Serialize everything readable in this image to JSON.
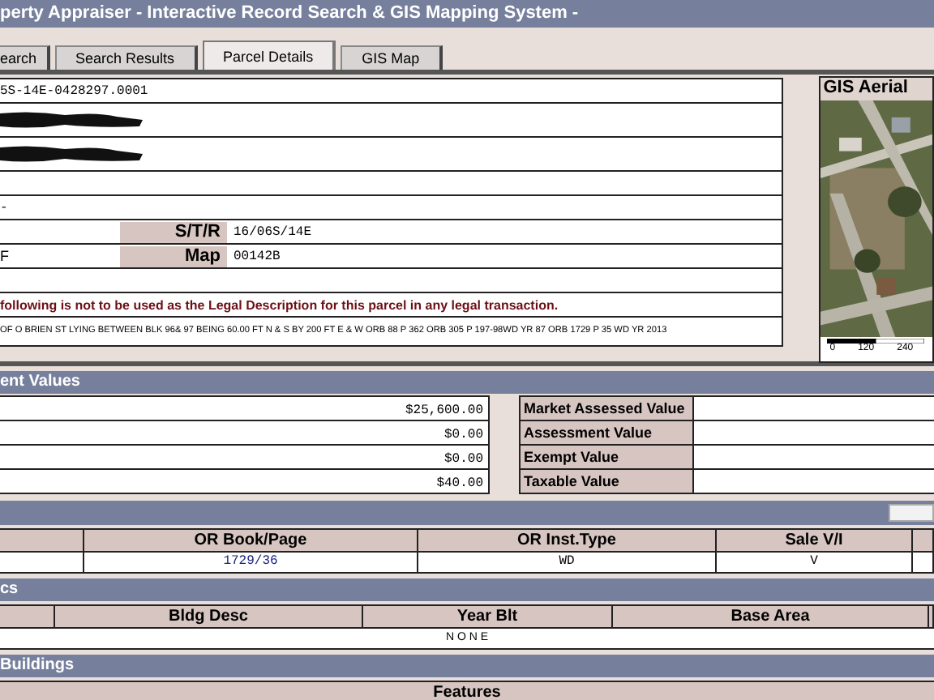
{
  "window": {
    "title": "perty Appraiser - Interactive Record Search & GIS Mapping System -"
  },
  "tabs": [
    {
      "label": "earch",
      "selected": false
    },
    {
      "label": "Search Results",
      "selected": false
    },
    {
      "label": "Parcel Details",
      "selected": true
    },
    {
      "label": "GIS Map",
      "selected": false
    }
  ],
  "parcel": [
    {
      "kind": "text",
      "value": "5S-14E-0428297.0001"
    },
    {
      "kind": "redacted"
    },
    {
      "kind": "redacted"
    },
    {
      "kind": "blank"
    },
    {
      "kind": "text",
      "value": "-"
    },
    {
      "kind": "field",
      "label": "S/T/R",
      "value": "16/06S/14E"
    },
    {
      "kind": "field",
      "left": "F",
      "label": "Map",
      "value": "00142B"
    },
    {
      "kind": "blank"
    },
    {
      "kind": "notice",
      "value": "following is not to be used as the Legal Description for this parcel in any legal transaction."
    },
    {
      "kind": "legal",
      "value": "OF O BRIEN ST LYING BETWEEN BLK 96& 97 BEING 60.00 FT N & S BY 200 FT E & W ORB 88 P 362 ORB 305 P 197-98WD YR 87 ORB 1729 P 35 WD YR 2013"
    }
  ],
  "gis": {
    "title": "GIS Aerial",
    "scale_labels": [
      "0",
      "120",
      "240"
    ]
  },
  "values": {
    "title": "ent Values",
    "amounts": [
      "$25,600.00",
      "$0.00",
      "$0.00",
      "$40.00"
    ],
    "labels": [
      "Market Assessed Value",
      "Assessment Value",
      "Exempt Value",
      "Taxable Value"
    ]
  },
  "sales": {
    "columns": [
      "OR Book/Page",
      "OR Inst.Type",
      "Sale V/I"
    ],
    "rows": [
      [
        "1729/36",
        "WD",
        "V"
      ]
    ]
  },
  "buildings": {
    "title": "cs",
    "columns": [
      "Bldg Desc",
      "Year Blt",
      "Base Area"
    ],
    "empty": "N O N E"
  },
  "extra": {
    "title": "Buildings",
    "column": "Features"
  }
}
